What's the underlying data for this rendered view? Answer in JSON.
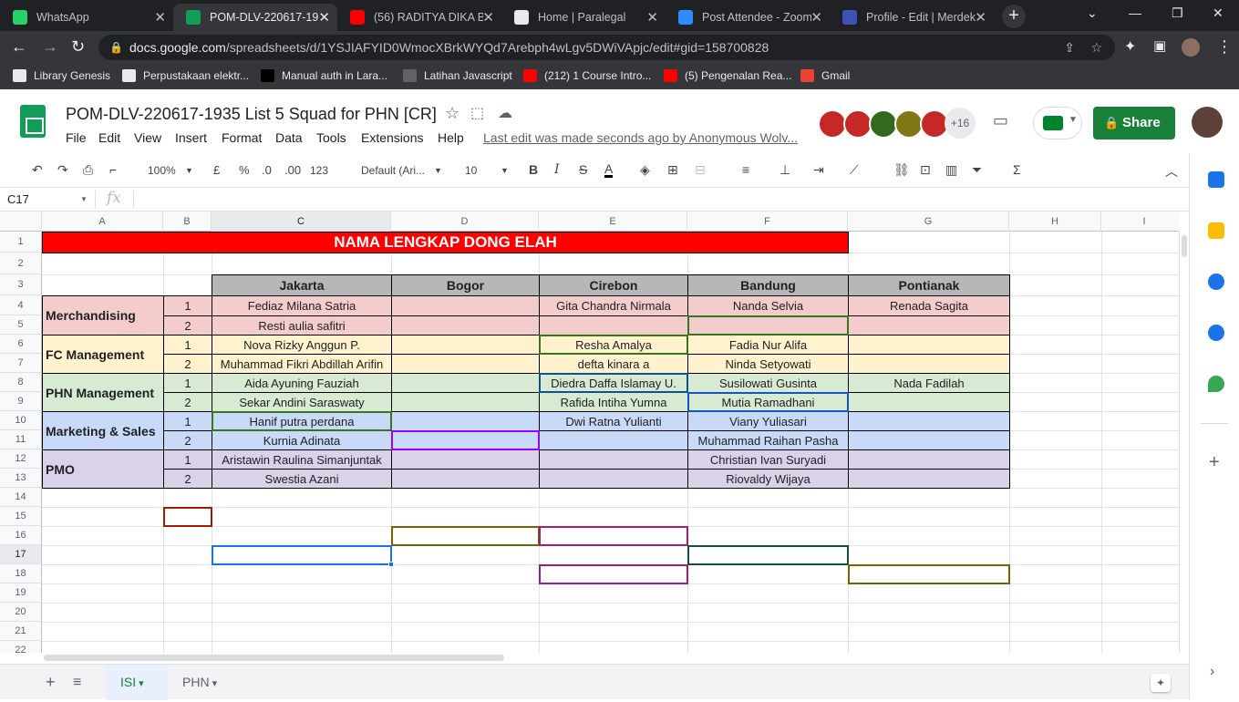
{
  "browser": {
    "tabs": [
      {
        "title": "WhatsApp",
        "icon": "whatsapp-icon",
        "color": "#25d366"
      },
      {
        "title": "POM-DLV-220617-19:",
        "icon": "sheets-icon",
        "color": "#0f9d58"
      },
      {
        "title": "(56) RADITYA DIKA BE",
        "icon": "youtube-icon",
        "color": "#ff0000"
      },
      {
        "title": "Home | Paralegal",
        "icon": "globe-icon",
        "color": "#e8eaed"
      },
      {
        "title": "Post Attendee - Zoom",
        "icon": "zoom-icon",
        "color": "#2d8cff"
      },
      {
        "title": "Profile - Edit | Merdek",
        "icon": "merdeka-icon",
        "color": "#3f51b5"
      }
    ],
    "url_domain": "docs.google.com",
    "url_path": "/spreadsheets/d/1YSJIAFYID0WmocXBrkWYQd7Arebph4wLgv5DWiVApjc/edit#gid=158700828",
    "bookmarks": [
      {
        "label": "Library Genesis",
        "icon": "library-icon",
        "color": "#e8eaed"
      },
      {
        "label": "Perpustakaan elektr...",
        "icon": "v-icon",
        "color": "#e8eaed"
      },
      {
        "label": "Manual auth in Lara...",
        "icon": "dev-icon",
        "color": "#000000"
      },
      {
        "label": "Latihan Javascript",
        "icon": "globe-icon",
        "color": "#5f6368"
      },
      {
        "label": "(212) 1 Course Intro...",
        "icon": "youtube-icon",
        "color": "#ff0000"
      },
      {
        "label": "(5) Pengenalan Rea...",
        "icon": "youtube-icon",
        "color": "#ff0000"
      },
      {
        "label": "Gmail",
        "icon": "gmail-icon",
        "color": "#ea4335"
      }
    ]
  },
  "doc": {
    "title": "POM-DLV-220617-1935 List 5 Squad for PHN [CR]",
    "menus": [
      "File",
      "Edit",
      "View",
      "Insert",
      "Format",
      "Data",
      "Tools",
      "Extensions",
      "Help"
    ],
    "last_edit": "Last edit was made seconds ago by Anonymous Wolv...",
    "collaborators_more": "+16",
    "share_label": "Share"
  },
  "toolbar": {
    "zoom": "100%",
    "currency": "£",
    "percent": "%",
    "dec_less": ".0",
    "dec_more": ".00",
    "format_123": "123",
    "font": "Default (Ari...",
    "size": "10"
  },
  "formula_bar": {
    "cell_ref": "C17",
    "fx": "fx"
  },
  "columns": [
    "A",
    "B",
    "C",
    "D",
    "E",
    "F",
    "G",
    "H",
    "I"
  ],
  "rows": [
    "1",
    "2",
    "3",
    "4",
    "5",
    "6",
    "7",
    "8",
    "9",
    "10",
    "11",
    "12",
    "13",
    "14",
    "15",
    "16",
    "17",
    "18",
    "19",
    "20",
    "21",
    "22"
  ],
  "sheet": {
    "title": "NAMA LENGKAP DONG ELAH",
    "cities": [
      "Jakarta",
      "Bogor",
      "Cirebon",
      "Bandung",
      "Pontianak"
    ],
    "groups": [
      {
        "name": "Merchandising",
        "color": "#f4cccc",
        "rows": [
          {
            "no": "1",
            "cells": [
              "Fediaz Milana Satria",
              "",
              "Gita Chandra Nirmala",
              "Nanda Selvia",
              "Renada Sagita"
            ]
          },
          {
            "no": "2",
            "cells": [
              "Resti aulia safitri",
              "",
              "",
              "",
              ""
            ]
          }
        ]
      },
      {
        "name": "FC Management",
        "color": "#fff2cc",
        "rows": [
          {
            "no": "1",
            "cells": [
              "Nova Rizky Anggun P.",
              "",
              "Resha Amalya",
              "Fadia Nur Alifa",
              ""
            ]
          },
          {
            "no": "2",
            "cells": [
              "Muhammad Fikri Abdillah Arifin",
              "",
              "defta kinara a",
              "Ninda Setyowati",
              ""
            ]
          }
        ]
      },
      {
        "name": "PHN Management",
        "color": "#d9ead3",
        "rows": [
          {
            "no": "1",
            "cells": [
              "Aida Ayuning Fauziah",
              "",
              "Diedra Daffa Islamay U.",
              "Susilowati Gusinta",
              "Nada Fadilah"
            ]
          },
          {
            "no": "2",
            "cells": [
              "Sekar Andini Saraswaty",
              "",
              "Rafida Intiha Yumna",
              "Mutia Ramadhani",
              ""
            ]
          }
        ]
      },
      {
        "name": "Marketing & Sales",
        "color": "#c9daf8",
        "rows": [
          {
            "no": "1",
            "cells": [
              "Hanif putra perdana",
              "",
              "Dwi Ratna Yulianti",
              "Viany Yuliasari",
              ""
            ]
          },
          {
            "no": "2",
            "cells": [
              "Kurnia Adinata",
              "",
              "",
              "Muhammad Raihan Pasha",
              ""
            ]
          }
        ]
      },
      {
        "name": "PMO",
        "color": "#d9d2e9",
        "rows": [
          {
            "no": "1",
            "cells": [
              "Aristawin Raulina Simanjuntak",
              "",
              "",
              "Christian Ivan Suryadi",
              ""
            ]
          },
          {
            "no": "2",
            "cells": [
              "Swestia Azani",
              "",
              "",
              "Riovaldy Wijaya",
              ""
            ]
          }
        ]
      }
    ]
  },
  "sheet_tabs": [
    {
      "label": "ISI",
      "active": true
    },
    {
      "label": "PHN",
      "active": false
    }
  ],
  "colors": {
    "accent": "#188038",
    "header_red": "#ff0000",
    "header_gray": "#b7b7b7"
  }
}
